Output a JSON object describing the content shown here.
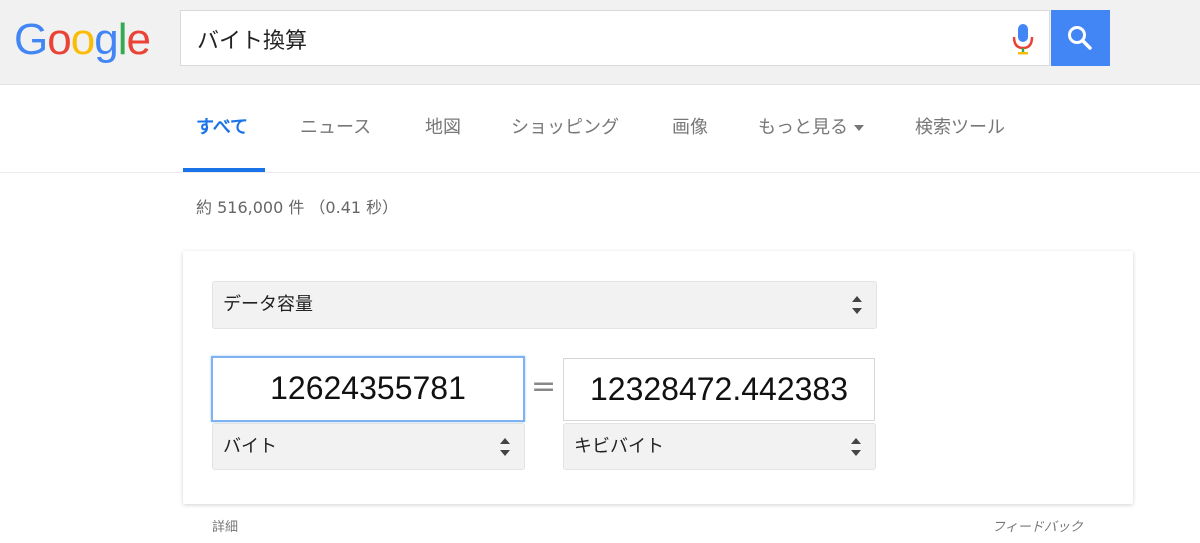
{
  "logo": {
    "letters": [
      "G",
      "o",
      "o",
      "g",
      "l",
      "e"
    ],
    "colors": [
      "#4285f4",
      "#ea4335",
      "#fbbc05",
      "#4285f4",
      "#34a853",
      "#ea4335"
    ]
  },
  "search": {
    "query": "バイト換算"
  },
  "tabs": [
    {
      "label": "すべて",
      "active": true
    },
    {
      "label": "ニュース"
    },
    {
      "label": "地図"
    },
    {
      "label": "ショッピング"
    },
    {
      "label": "画像"
    },
    {
      "label": "もっと見る"
    },
    {
      "label": "検索ツール"
    }
  ],
  "stats": "約 516,000 件 （0.41 秒）",
  "converter": {
    "category": "データ容量",
    "from_value": "12624355781",
    "equals": "=",
    "to_value": "12328472.442383",
    "from_unit": "バイト",
    "to_unit": "キビバイト"
  },
  "footer": {
    "details": "詳細",
    "feedback": "フィードバック"
  },
  "colors": {
    "accent": "#1a73e8",
    "search_button": "#4285f4"
  }
}
